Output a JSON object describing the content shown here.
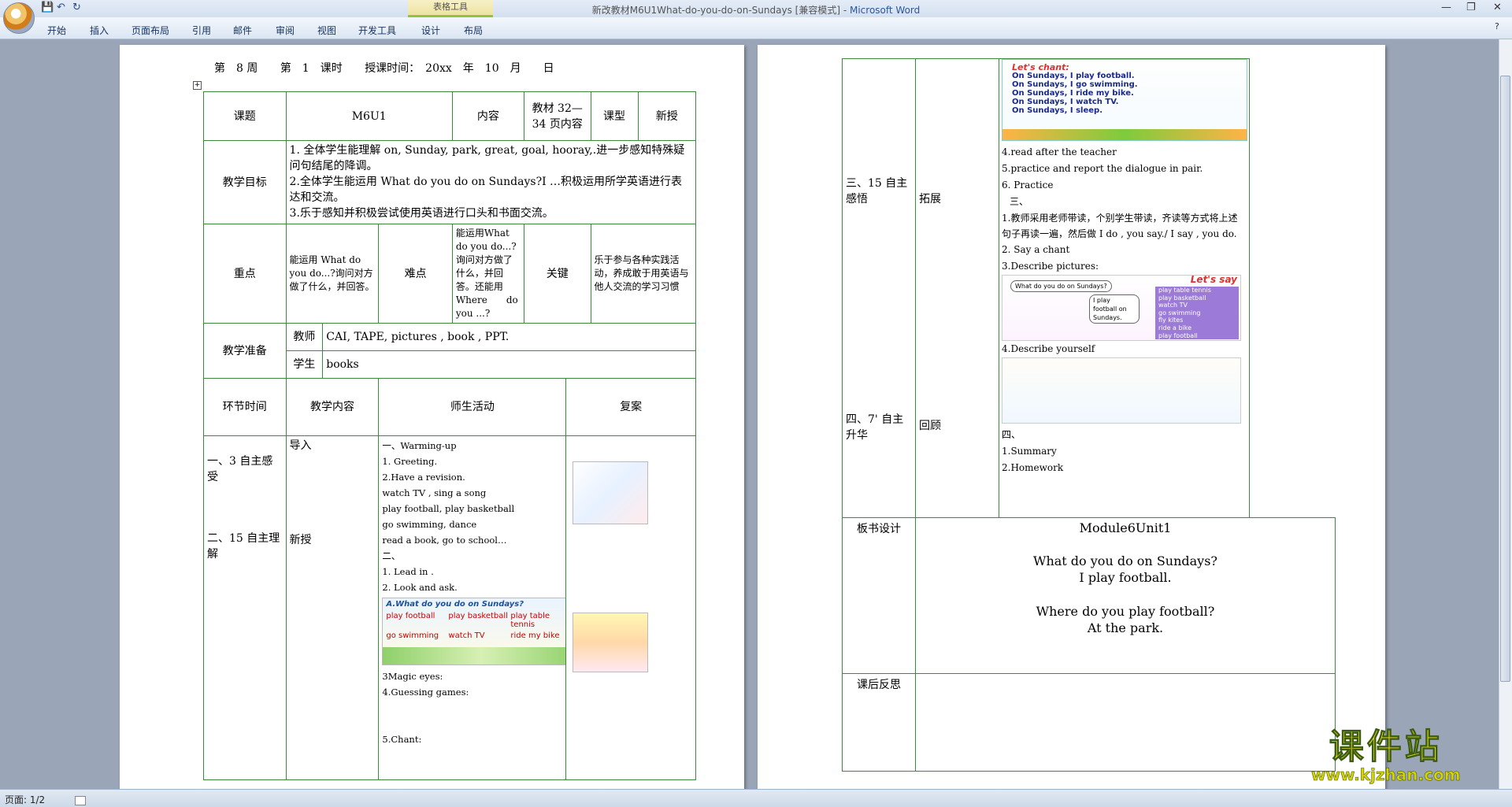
{
  "window": {
    "doc_name": "新改教材M6U1What-do-you-do-on-Sundays [兼容模式] -",
    "app_name": "Microsoft Word"
  },
  "ribbon": {
    "context_group": "表格工具",
    "tabs": [
      "开始",
      "插入",
      "页面布局",
      "引用",
      "邮件",
      "审阅",
      "视图",
      "开发工具",
      "设计",
      "布局"
    ]
  },
  "status": {
    "page": "页面: 1/2"
  },
  "watermark": {
    "title": "课件站",
    "url": "www.kjzhan.com"
  },
  "page1": {
    "header": {
      "week": "第　8 周",
      "period": "第　1　课时",
      "date": "授课时间：　20xx　年　10　月　　日"
    },
    "r1": {
      "k1": "课题",
      "v1": "M6U1",
      "k2": "内容",
      "v2": "教材 32—34 页内容",
      "k3": "课型",
      "v3": "新授"
    },
    "goals": {
      "label": "教学目标",
      "l1": "1. 全体学生能理解 on, Sunday, park, great, goal, hooray,.进一步感知特殊疑问句结尾的降调。",
      "l2": "2.全体学生能运用 What do you do on Sundays?I …积极运用所学英语进行表达和交流。",
      "l3": "3.乐于感知并积极尝试使用英语进行口头和书面交流。"
    },
    "r3": {
      "k1": "重点",
      "v1": "能运用 What do you do...?询问对方　做了什么，并回答。",
      "k2": "难点",
      "v2": "能运用What do you do...?询问对方做了什么，并回答。还能用 Where　　do you ...?",
      "k3": "关键",
      "v3": "乐于参与各种实践活动，养成敢于用英语与他人交流的学习习惯"
    },
    "prep": {
      "label": "教学准备",
      "teacher": "教师",
      "teacher_v": "CAI, TAPE, pictures , book , PPT.",
      "student": "学生",
      "student_v": "books"
    },
    "head4": {
      "a": "环节时间",
      "b": "教学内容",
      "c": "师生活动",
      "d": "复案"
    },
    "stage1": "一、3 自主感受",
    "stage2": "二、15 自主理解",
    "content1": "导入",
    "content2": "新授",
    "acts": [
      "一、Warming-up",
      "1. Greeting.",
      "2.Have a revision.",
      "watch TV , sing a song",
      "play football, play basketball",
      "go swimming,  dance",
      "read a book, go to school…",
      "二、",
      "1. Lead in .",
      "2. Look and ask.",
      "3Magic eyes:",
      "4.Guessing games:",
      "5.Chant:"
    ],
    "pic1_title": "A.What do you do on Sundays?",
    "pic1_items": [
      "play football",
      "play basketball",
      "play table tennis",
      "go swimming",
      "watch TV",
      "ride my bike"
    ]
  },
  "page2": {
    "stage3": "三、15 自主感悟",
    "stage4": "四、7' 自主升华",
    "c3": "拓展",
    "c4": "回顾",
    "chant": {
      "title": "Let's chant:",
      "lines": [
        "On Sundays,  I play football.",
        "On Sundays,  I go swimming.",
        "On Sundays,  I ride my bike.",
        "On Sundays,  I watch TV.",
        "On Sundays,  I sleep."
      ]
    },
    "acts": [
      "4.read after the teacher",
      "5.practice and report the dialogue in pair.",
      "6. Practice",
      "三、",
      "1.教师采用老师带读，个别学生带读，齐读等方式将上述句子再读一遍，然后做 I do , you say./ I say , you do.",
      "2. Say a chant",
      "3.Describe pictures:",
      "4.Describe yourself",
      "四、",
      "1.Summary",
      "2.Homework"
    ],
    "say": {
      "title": "Let's say",
      "bubble": "What do you do on Sundays?",
      "reply": "I play football on Sundays.",
      "items": [
        "play table tennis",
        "play basketball",
        "watch TV",
        "go swimming",
        "fly kites",
        "ride a bike",
        "play football"
      ]
    },
    "bb_label": "板书设计",
    "bb": [
      "Module6Unit1",
      "What do you do on Sundays?",
      "I play football.",
      "Where do you play football?",
      "At the park."
    ],
    "reflect": "课后反思"
  }
}
